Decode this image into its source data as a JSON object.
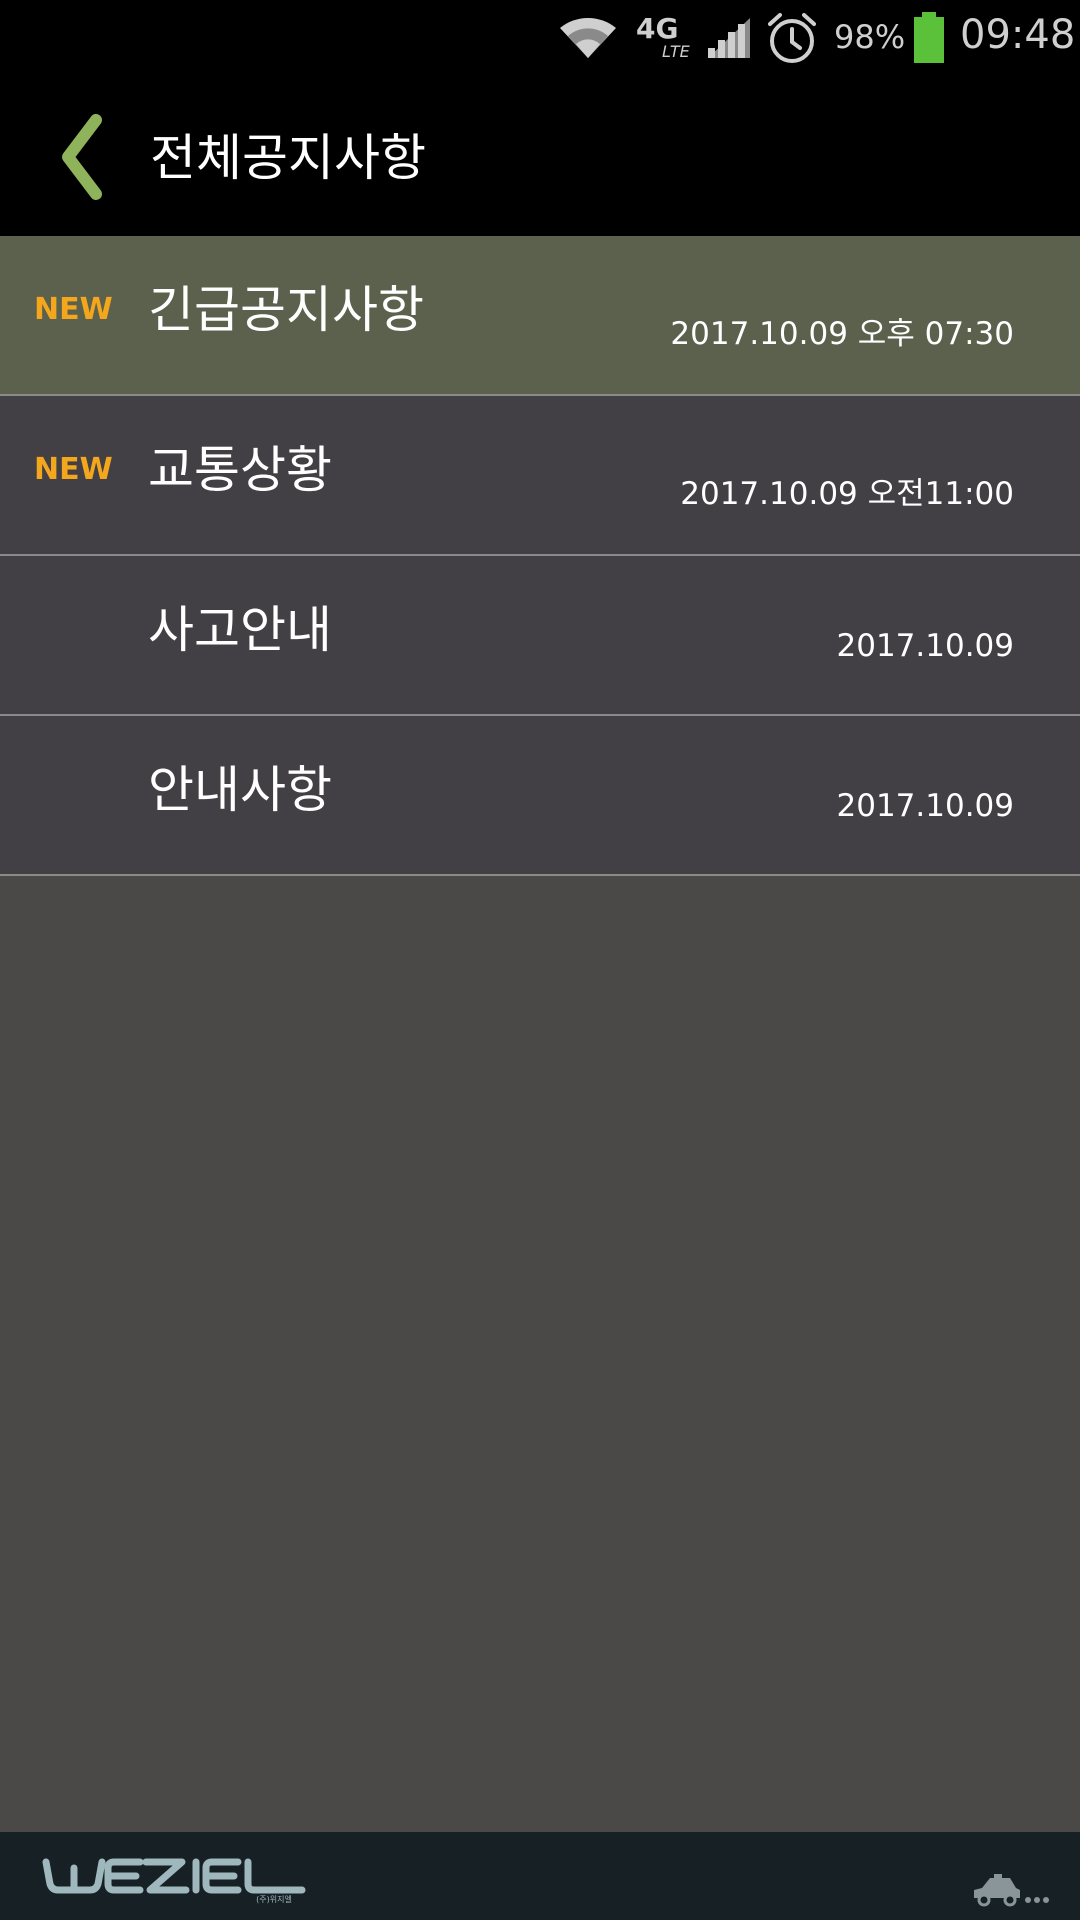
{
  "status_bar": {
    "network_label": "4G",
    "network_sub": "LTE",
    "battery_percent": "98%",
    "time": "09:48"
  },
  "header": {
    "title": "전체공지사항"
  },
  "notices": [
    {
      "badge": "NEW",
      "title": "긴급공지사항",
      "date": "2017.10.09 오후 07:30",
      "highlighted": true
    },
    {
      "badge": "NEW",
      "title": "교통상황",
      "date": "2017.10.09 오전11:00",
      "highlighted": false
    },
    {
      "badge": "",
      "title": "사고안내",
      "date": "2017.10.09",
      "highlighted": false
    },
    {
      "badge": "",
      "title": "안내사항",
      "date": "2017.10.09",
      "highlighted": false
    }
  ],
  "footer": {
    "brand": "WEZIEL",
    "brand_sub": "(주)위지엘"
  },
  "colors": {
    "accent_green": "#8fb35b",
    "badge_orange": "#f4a61d",
    "highlight_row": "#5c614d",
    "row": "#434045",
    "battery_green": "#5cc13a"
  }
}
